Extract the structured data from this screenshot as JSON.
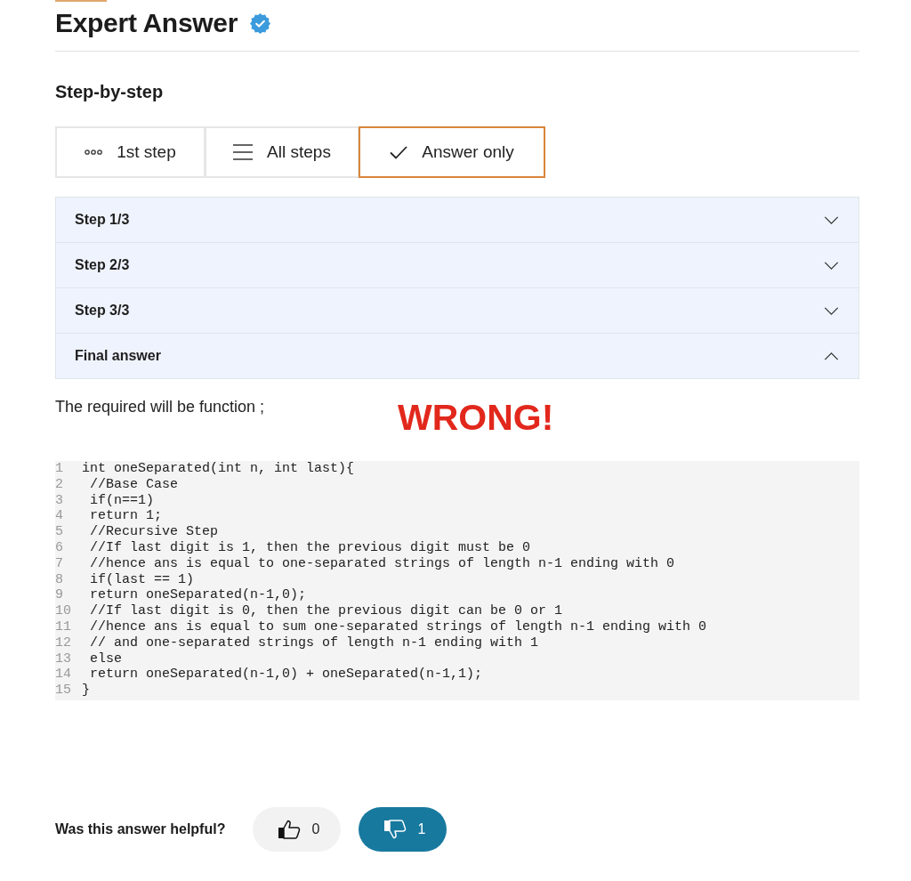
{
  "title": "Expert Answer",
  "subtitle": "Step-by-step",
  "tabs": [
    {
      "label": "1st step",
      "kind": "dots",
      "selected": false
    },
    {
      "label": "All steps",
      "kind": "lines",
      "selected": false
    },
    {
      "label": "Answer only",
      "kind": "check",
      "selected": true
    }
  ],
  "sections": [
    {
      "label": "Step 1/3",
      "expanded": false
    },
    {
      "label": "Step 2/3",
      "expanded": false
    },
    {
      "label": "Step 3/3",
      "expanded": false
    },
    {
      "label": "Final answer",
      "expanded": true
    }
  ],
  "answer": {
    "intro": "The required will be function ;",
    "annotation": "WRONG!",
    "code_lines": [
      {
        "number": "1",
        "code": "int oneSeparated(int n, int last){"
      },
      {
        "number": "2",
        "code": " //Base Case"
      },
      {
        "number": "3",
        "code": " if(n==1)"
      },
      {
        "number": "4",
        "code": " return 1;"
      },
      {
        "number": "5",
        "code": " //Recursive Step"
      },
      {
        "number": "6",
        "code": " //If last digit is 1, then the previous digit must be 0"
      },
      {
        "number": "7",
        "code": " //hence ans is equal to one-separated strings of length n-1 ending with 0"
      },
      {
        "number": "8",
        "code": " if(last == 1)"
      },
      {
        "number": "9",
        "code": " return oneSeparated(n-1,0);"
      },
      {
        "number": "10",
        "code": " //If last digit is 0, then the previous digit can be 0 or 1"
      },
      {
        "number": "11",
        "code": " //hence ans is equal to sum one-separated strings of length n-1 ending with 0"
      },
      {
        "number": "12",
        "code": " // and one-separated strings of length n-1 ending with 1"
      },
      {
        "number": "13",
        "code": " else"
      },
      {
        "number": "14",
        "code": " return oneSeparated(n-1,0) + oneSeparated(n-1,1);"
      },
      {
        "number": "15",
        "code": "}"
      }
    ]
  },
  "feedback": {
    "question": "Was this answer helpful?",
    "votes": [
      {
        "kind": "like",
        "count": "0",
        "selected": false
      },
      {
        "kind": "dislike",
        "count": "1",
        "selected": true
      }
    ]
  }
}
